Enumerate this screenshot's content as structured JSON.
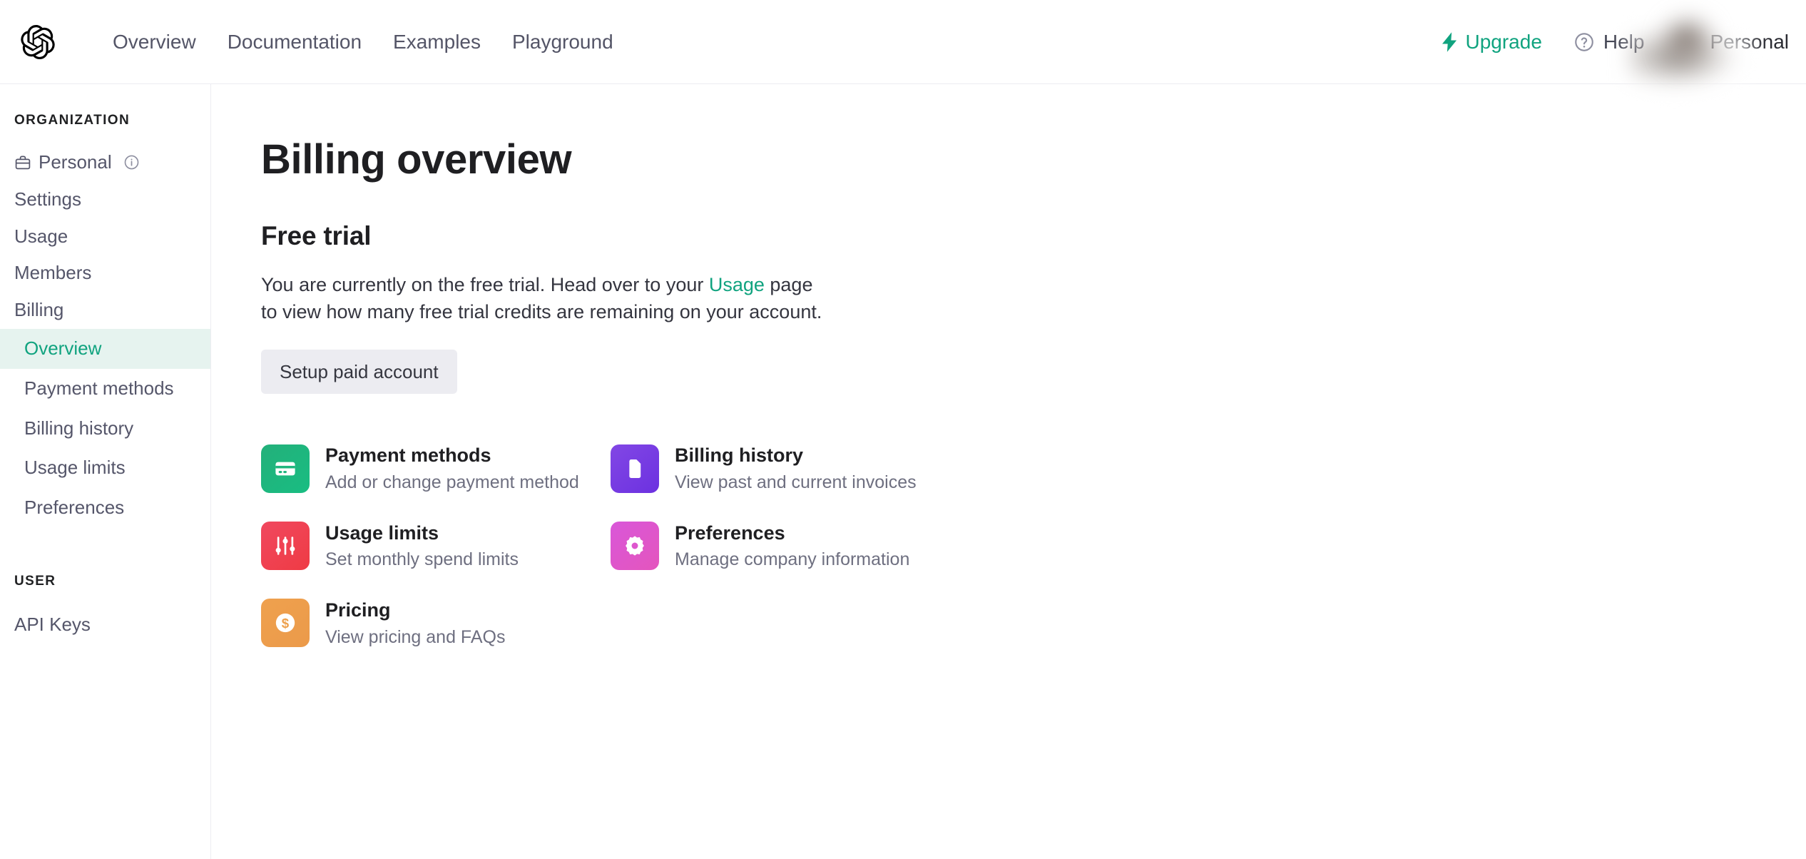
{
  "header": {
    "logo_icon": "openai-logo-icon",
    "nav": [
      {
        "label": "Overview"
      },
      {
        "label": "Documentation"
      },
      {
        "label": "Examples"
      },
      {
        "label": "Playground"
      }
    ],
    "upgrade": {
      "label": "Upgrade",
      "icon": "bolt-icon",
      "color": "#10a37f"
    },
    "help": {
      "label": "Help",
      "icon": "question-circle-icon"
    },
    "account": {
      "name": "Personal",
      "avatar": "user-avatar"
    }
  },
  "sidebar": {
    "organization_label": "ORGANIZATION",
    "org_items": [
      {
        "label": "Personal",
        "icon": "briefcase-icon",
        "has_info": true
      },
      {
        "label": "Settings"
      },
      {
        "label": "Usage"
      },
      {
        "label": "Members"
      },
      {
        "label": "Billing"
      }
    ],
    "billing_subitems": [
      {
        "label": "Overview",
        "active": true
      },
      {
        "label": "Payment methods",
        "active": false
      },
      {
        "label": "Billing history",
        "active": false
      },
      {
        "label": "Usage limits",
        "active": false
      },
      {
        "label": "Preferences",
        "active": false
      }
    ],
    "user_label": "USER",
    "user_items": [
      {
        "label": "API Keys"
      }
    ],
    "active_color": "#10a37f",
    "active_bg": "#e6f3ef"
  },
  "main": {
    "page_title": "Billing overview",
    "free_trial": {
      "heading": "Free trial",
      "body_part1": "You are currently on the free trial. Head over to your ",
      "link_text": "Usage",
      "body_part2": " page to view how many free trial credits are remaining on your account.",
      "button_label": "Setup paid account"
    },
    "cards": [
      {
        "title": "Payment methods",
        "subtitle": "Add or change payment method",
        "icon": "credit-card-icon",
        "color": "#1fb67e",
        "column": "left"
      },
      {
        "title": "Billing history",
        "subtitle": "View past and current invoices",
        "icon": "document-icon",
        "color": "#7139e3",
        "column": "right"
      },
      {
        "title": "Usage limits",
        "subtitle": "Set monthly spend limits",
        "icon": "sliders-icon",
        "color": "#ef4050",
        "column": "left"
      },
      {
        "title": "Preferences",
        "subtitle": "Manage company information",
        "icon": "gear-icon",
        "color": "#de56ce",
        "column": "right"
      },
      {
        "title": "Pricing",
        "subtitle": "View pricing and FAQs",
        "icon": "dollar-circle-icon",
        "color": "#eda04c",
        "column": "left"
      }
    ]
  }
}
